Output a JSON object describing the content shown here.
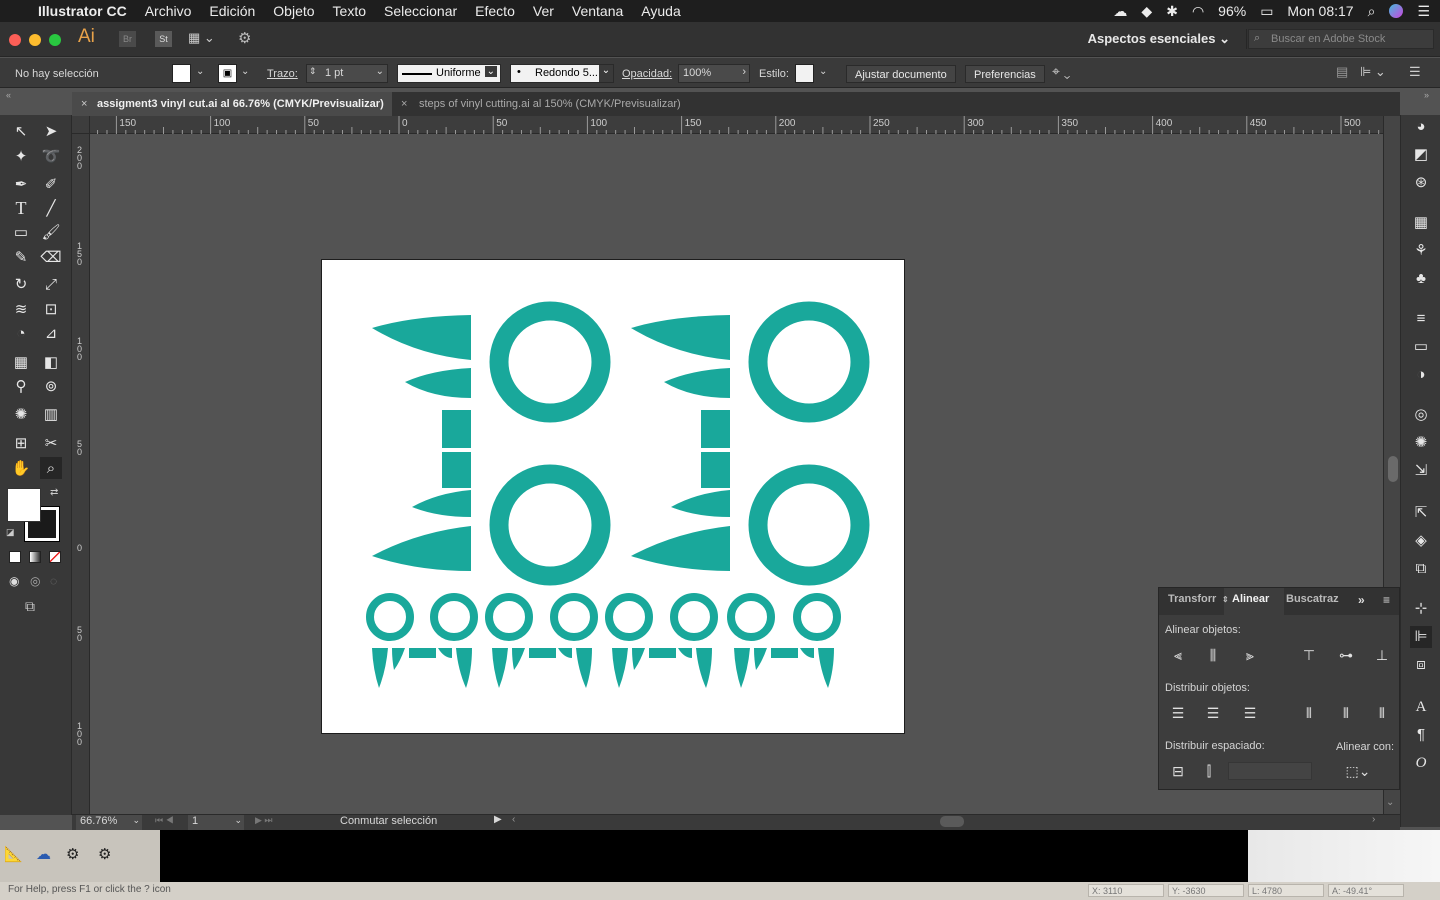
{
  "menubar": {
    "app": "Illustrator CC",
    "items": [
      "Archivo",
      "Edición",
      "Objeto",
      "Texto",
      "Seleccionar",
      "Efecto",
      "Ver",
      "Ventana",
      "Ayuda"
    ],
    "battery": "96%",
    "clock": "Mon 08:17"
  },
  "appbar": {
    "logo": "Ai",
    "br": "Br",
    "st": "St",
    "workspace": "Aspectos esenciales",
    "stock_placeholder": "Buscar en Adobe Stock"
  },
  "control": {
    "selection": "No hay selección",
    "stroke_label": "Trazo:",
    "stroke_value": "1 pt",
    "profile": "Uniforme",
    "brush": "Redondo 5...",
    "opacity_label": "Opacidad:",
    "opacity_value": "100%",
    "style_label": "Estilo:",
    "adjust_button": "Ajustar documento",
    "prefs_button": "Preferencias"
  },
  "tabs": [
    {
      "label": "assigment3 vinyl cut.ai al 66.76% (CMYK/Previsualizar)",
      "active": true
    },
    {
      "label": "steps of vinyl cutting.ai al 150% (CMYK/Previsualizar)",
      "active": false
    }
  ],
  "ruler": {
    "top": [
      "150",
      "100",
      "50",
      "0",
      "50",
      "100",
      "150",
      "200",
      "250",
      "300",
      "350",
      "400",
      "450",
      "500"
    ],
    "left": [
      "200",
      "150",
      "100",
      "50",
      "0",
      "50",
      "100"
    ]
  },
  "align_panel": {
    "tabs": [
      "Transforr",
      "Alinear",
      "Buscatraz"
    ],
    "align_objects": "Alinear objetos:",
    "distribute_objects": "Distribuir objetos:",
    "distribute_spacing": "Distribuir espaciado:",
    "align_to": "Alinear con:"
  },
  "status": {
    "zoom": "66.76%",
    "artboard": "1",
    "toggle": "Conmutar selección"
  },
  "help": {
    "text": "For Help, press F1 or click the ? icon",
    "x": "X: 3110",
    "y": "Y: -3630",
    "l": "L: 4780",
    "a": "A: -49.41°"
  },
  "colors": {
    "accent": "#19a89b",
    "canvas": "#535353",
    "panel": "#383838"
  }
}
